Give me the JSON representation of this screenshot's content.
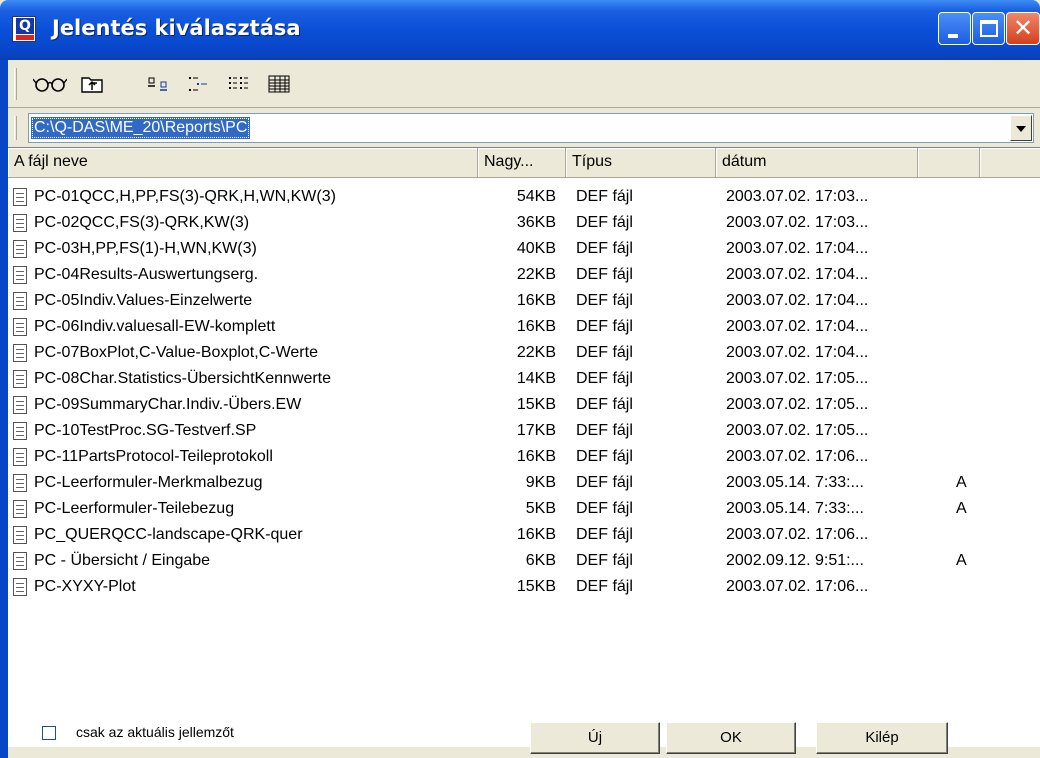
{
  "window": {
    "title": "Jelentés kiválasztása",
    "app_icon_letter": "Q",
    "controls": {
      "minimize": "_",
      "maximize": "□",
      "close": "X"
    }
  },
  "toolbar": {
    "icons": [
      "glasses-icon",
      "folder-up-icon",
      "large-icons-view-icon",
      "small-icons-view-icon",
      "list-view-icon",
      "details-view-icon"
    ]
  },
  "path": {
    "value": "C:\\Q-DAS\\ME_20\\Reports\\PC"
  },
  "list": {
    "columns": [
      "A fájl neve",
      "Nagy...",
      "Típus",
      "dátum",
      ""
    ],
    "rows": [
      {
        "name": "PC-01QCC,H,PP,FS(3)-QRK,H,WN,KW(3)",
        "size": "54KB",
        "type": "DEF fájl",
        "date": "2003.07.02. 17:03...",
        "attr": ""
      },
      {
        "name": "PC-02QCC,FS(3)-QRK,KW(3)",
        "size": "36KB",
        "type": "DEF fájl",
        "date": "2003.07.02. 17:03...",
        "attr": ""
      },
      {
        "name": "PC-03H,PP,FS(1)-H,WN,KW(3)",
        "size": "40KB",
        "type": "DEF fájl",
        "date": "2003.07.02. 17:04...",
        "attr": ""
      },
      {
        "name": "PC-04Results-Auswertungserg.",
        "size": "22KB",
        "type": "DEF fájl",
        "date": "2003.07.02. 17:04...",
        "attr": ""
      },
      {
        "name": "PC-05Indiv.Values-Einzelwerte",
        "size": "16KB",
        "type": "DEF fájl",
        "date": "2003.07.02. 17:04...",
        "attr": ""
      },
      {
        "name": "PC-06Indiv.valuesall-EW-komplett",
        "size": "16KB",
        "type": "DEF fájl",
        "date": "2003.07.02. 17:04...",
        "attr": ""
      },
      {
        "name": "PC-07BoxPlot,C-Value-Boxplot,C-Werte",
        "size": "22KB",
        "type": "DEF fájl",
        "date": "2003.07.02. 17:04...",
        "attr": ""
      },
      {
        "name": "PC-08Char.Statistics-ÜbersichtKennwerte",
        "size": "14KB",
        "type": "DEF fájl",
        "date": "2003.07.02. 17:05...",
        "attr": ""
      },
      {
        "name": "PC-09SummaryChar.Indiv.-Übers.EW",
        "size": "15KB",
        "type": "DEF fájl",
        "date": "2003.07.02. 17:05...",
        "attr": ""
      },
      {
        "name": "PC-10TestProc.SG-Testverf.SP",
        "size": "17KB",
        "type": "DEF fájl",
        "date": "2003.07.02. 17:05...",
        "attr": ""
      },
      {
        "name": "PC-11PartsProtocol-Teileprotokoll",
        "size": "16KB",
        "type": "DEF fájl",
        "date": "2003.07.02. 17:06...",
        "attr": ""
      },
      {
        "name": "PC-Leerformuler-Merkmalbezug",
        "size": "9KB",
        "type": "DEF fájl",
        "date": "2003.05.14. 7:33:...",
        "attr": "A"
      },
      {
        "name": "PC-Leerformuler-Teilebezug",
        "size": "5KB",
        "type": "DEF fájl",
        "date": "2003.05.14. 7:33:...",
        "attr": "A"
      },
      {
        "name": "PC_QUERQCC-landscape-QRK-quer",
        "size": "16KB",
        "type": "DEF fájl",
        "date": "2003.07.02. 17:06...",
        "attr": ""
      },
      {
        "name": "PC - Übersicht / Eingabe",
        "size": "6KB",
        "type": "DEF fájl",
        "date": "2002.09.12. 9:51:...",
        "attr": "A"
      },
      {
        "name": "PC-XYXY-Plot",
        "size": "15KB",
        "type": "DEF fájl",
        "date": "2003.07.02. 17:06...",
        "attr": ""
      }
    ]
  },
  "footer": {
    "checkbox_label": "csak az aktuális jellemzőt",
    "checkbox_checked": false,
    "new_label": "Új",
    "ok_label": "OK",
    "exit_label": "Kilép"
  }
}
